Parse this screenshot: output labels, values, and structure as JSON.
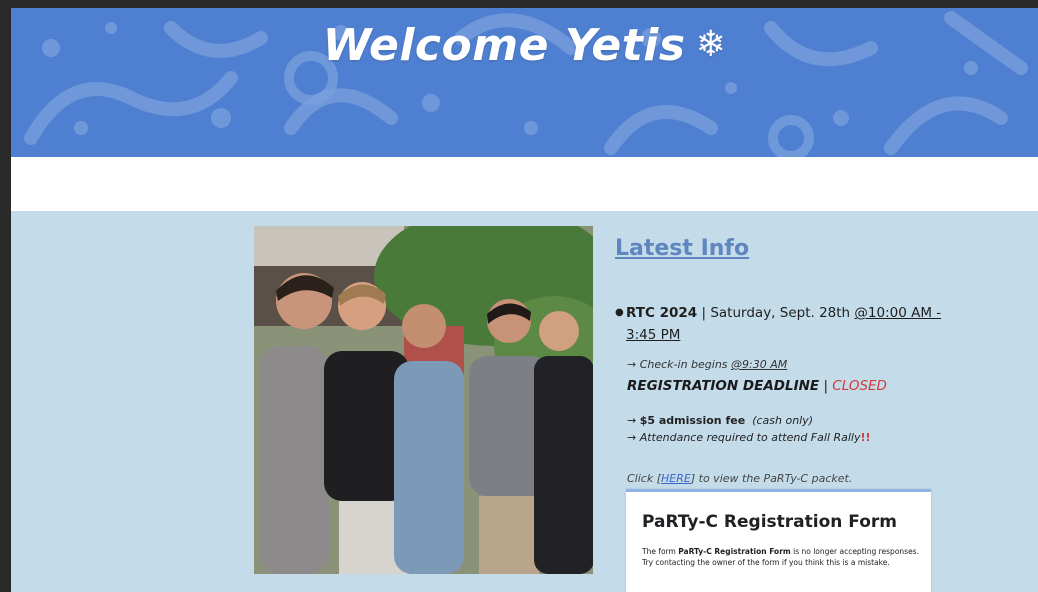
{
  "banner": {
    "title": "Welcome Yetis",
    "icon": "snowflake-icon",
    "color": "#4f7fd0"
  },
  "photo": {
    "description_icon": "group-photo"
  },
  "info": {
    "heading": "Latest Info",
    "event_name": "RTC 2024",
    "event_sep": "|",
    "event_date": "Saturday, Sept. 28th",
    "event_time_a": "@10:00 AM -",
    "event_time_b": "3:45 PM",
    "checkin_prefix": "→ Check-in begins",
    "checkin_time": "@9:30 AM",
    "deadline_label": "REGISTRATION DEADLINE",
    "deadline_sep": "|",
    "deadline_status": "CLOSED",
    "fee_arrow": "→",
    "fee_label": "$5 admission fee",
    "fee_note": "(cash only)",
    "attend_text": "→ Attendance required to attend Fall Rally",
    "attend_mark": "!!",
    "packet_prefix": "Click",
    "packet_link": "HERE",
    "packet_suffix": "to view the PaRTy-C packet."
  },
  "form": {
    "title": "PaRTy-C Registration Form",
    "msg_prefix": "The form",
    "msg_name": "PaRTy-C Registration Form",
    "msg_suffix": "is no longer accepting responses.",
    "msg_line2": "Try contacting the owner of the form if you think this is a mistake."
  }
}
